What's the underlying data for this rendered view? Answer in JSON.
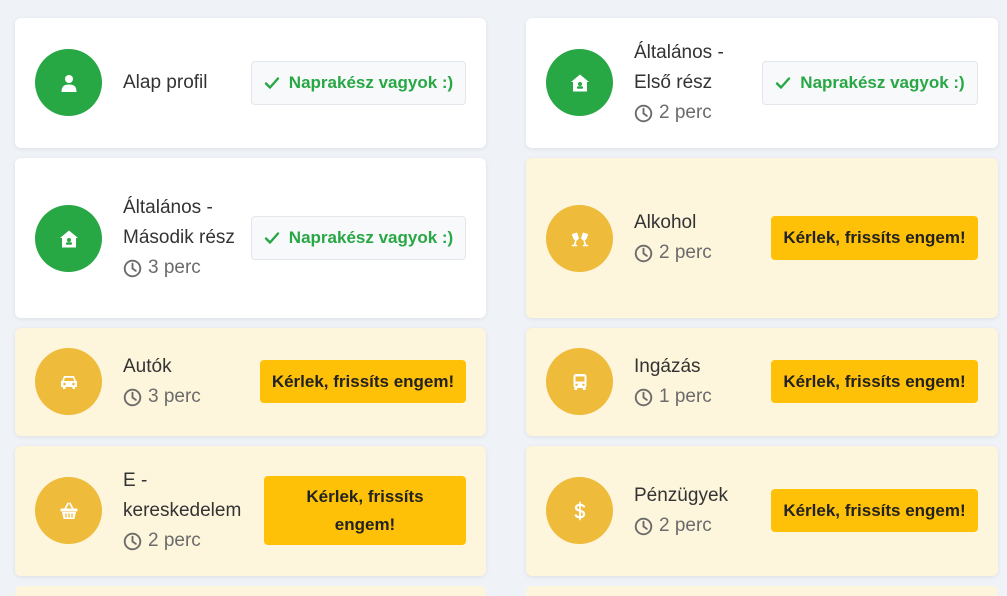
{
  "labels": {
    "up_to_date": "Naprakész vagyok :)",
    "refresh": "Kérlek, frissíts engem!"
  },
  "colors": {
    "done": "#28a745",
    "pending": "#eebb3b",
    "refresh_button": "#ffc107",
    "pending_card": "#fdf5dc"
  },
  "cards": [
    {
      "title": "Alap profil",
      "duration": "",
      "status": "done",
      "icon": "user-icon"
    },
    {
      "title": "Általános - Első rész",
      "duration": "2 perc",
      "status": "done",
      "icon": "home-icon"
    },
    {
      "title": "Általános - Második rész",
      "duration": "3 perc",
      "status": "done",
      "icon": "home-icon"
    },
    {
      "title": "Alkohol",
      "duration": "2 perc",
      "status": "pending",
      "icon": "glass-cheers-icon"
    },
    {
      "title": "Autók",
      "duration": "3 perc",
      "status": "pending",
      "icon": "car-icon"
    },
    {
      "title": "Ingázás",
      "duration": "1 perc",
      "status": "pending",
      "icon": "bus-icon"
    },
    {
      "title": "E - kereskedelem",
      "duration": "2 perc",
      "status": "pending",
      "icon": "shopping-basket-icon"
    },
    {
      "title": "Pénzügyek",
      "duration": "2 perc",
      "status": "pending",
      "icon": "dollar-icon"
    }
  ]
}
